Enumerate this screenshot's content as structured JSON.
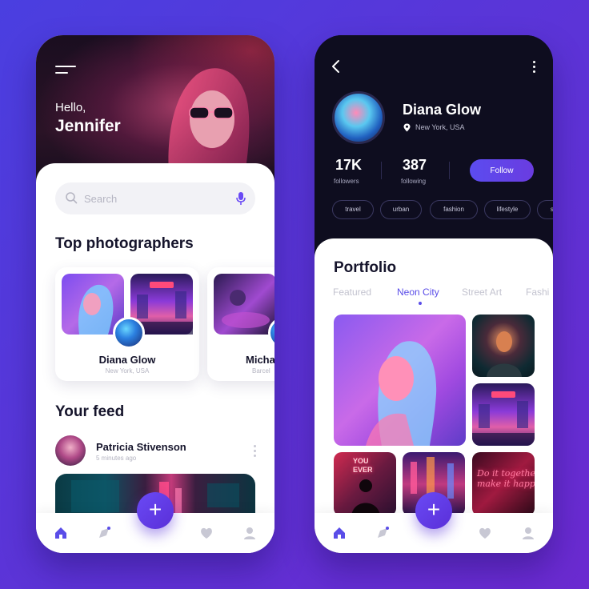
{
  "left_screen": {
    "greeting": "Hello,",
    "user_name": "Jennifer",
    "search": {
      "placeholder": "Search"
    },
    "top_photographers": {
      "title": "Top photographers",
      "cards": [
        {
          "name": "Diana Glow",
          "location": "New York, USA"
        },
        {
          "name": "Micha",
          "location": "Barcel"
        }
      ]
    },
    "feed": {
      "title": "Your feed",
      "post": {
        "author": "Patricia Stivenson",
        "time": "5 minutes ago"
      }
    },
    "fab_label": "+"
  },
  "right_screen": {
    "profile": {
      "name": "Diana Glow",
      "location": "New York, USA",
      "followers_count": "17K",
      "followers_label": "followers",
      "following_count": "387",
      "following_label": "following",
      "follow_button": "Follow"
    },
    "tags": [
      "travel",
      "urban",
      "fashion",
      "lifestyle",
      "st"
    ],
    "portfolio": {
      "title": "Portfolio",
      "tabs": [
        "Featured",
        "Neon City",
        "Street Art",
        "Fashi"
      ],
      "active_tab": "Neon City",
      "neon_sign_text": "Do it together\nmake it happen",
      "you_sign_text": "YOU\nEVER"
    },
    "fab_label": "+"
  },
  "colors": {
    "background_start": "#4a3fe0",
    "background_end": "#6b2ad0",
    "accent": "#5a4de8",
    "dark_header": "#0e0d1f",
    "nav_active": "#5a4de8",
    "nav_inactive": "#c8c8d4"
  },
  "icons": {
    "left_nav": [
      "home-icon",
      "explore-icon",
      "heart-icon",
      "user-icon"
    ],
    "right_nav": [
      "home-icon",
      "explore-icon",
      "heart-icon",
      "user-icon"
    ]
  }
}
